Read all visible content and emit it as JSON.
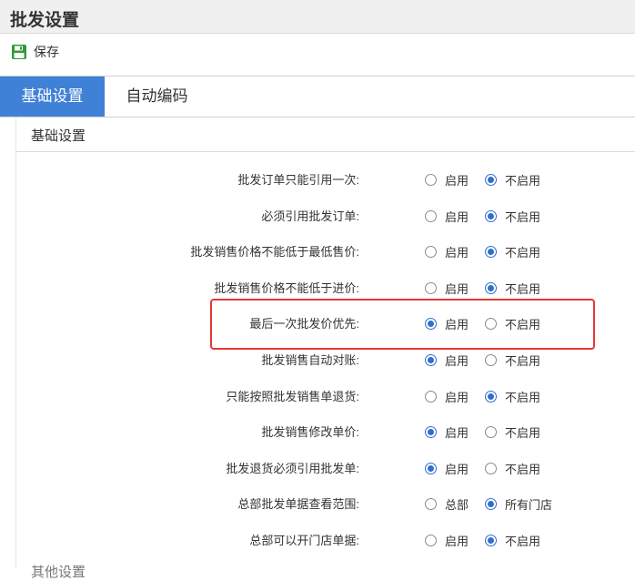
{
  "header": {
    "title": "批发设置"
  },
  "toolbar": {
    "save_label": "保存"
  },
  "tabs": [
    {
      "label": "基础设置",
      "active": true
    },
    {
      "label": "自动编码",
      "active": false
    }
  ],
  "section": {
    "title": "基础设置"
  },
  "settings": [
    {
      "label": "批发订单只能引用一次:",
      "options": [
        "启用",
        "不启用"
      ],
      "selected": 1
    },
    {
      "label": "必须引用批发订单:",
      "options": [
        "启用",
        "不启用"
      ],
      "selected": 1
    },
    {
      "label": "批发销售价格不能低于最低售价:",
      "options": [
        "启用",
        "不启用"
      ],
      "selected": 1
    },
    {
      "label": "批发销售价格不能低于进价:",
      "options": [
        "启用",
        "不启用"
      ],
      "selected": 1
    },
    {
      "label": "最后一次批发价优先:",
      "options": [
        "启用",
        "不启用"
      ],
      "selected": 0
    },
    {
      "label": "批发销售自动对账:",
      "options": [
        "启用",
        "不启用"
      ],
      "selected": 0
    },
    {
      "label": "只能按照批发销售单退货:",
      "options": [
        "启用",
        "不启用"
      ],
      "selected": 1
    },
    {
      "label": "批发销售修改单价:",
      "options": [
        "启用",
        "不启用"
      ],
      "selected": 0
    },
    {
      "label": "批发退货必须引用批发单:",
      "options": [
        "启用",
        "不启用"
      ],
      "selected": 0
    },
    {
      "label": "总部批发单据查看范围:",
      "options": [
        "总部",
        "所有门店"
      ],
      "selected": 1
    },
    {
      "label": "总部可以开门店单据:",
      "options": [
        "启用",
        "不启用"
      ],
      "selected": 1
    }
  ],
  "next_section": {
    "title": "其他设置"
  },
  "colors": {
    "accent": "#3f81d6",
    "radio_on": "#2f6fcc",
    "highlight": "#e53935",
    "save_icon": "#2e9b3a"
  }
}
